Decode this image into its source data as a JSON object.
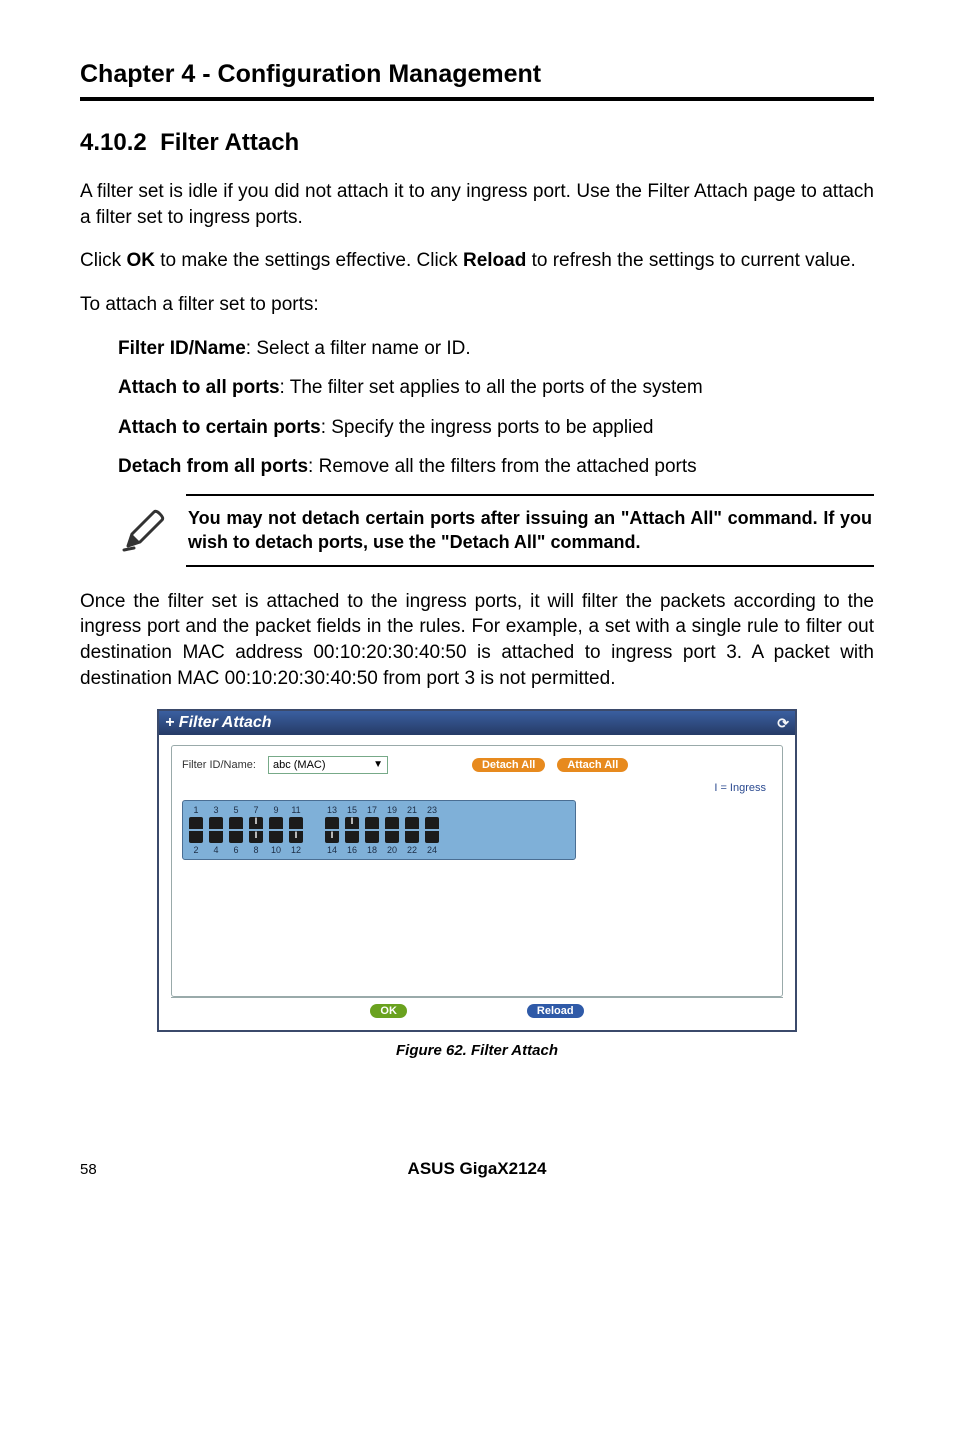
{
  "chapter": "Chapter 4 - Configuration Management",
  "section": {
    "number": "4.10.2",
    "title": "Filter Attach"
  },
  "p1": "A filter set is idle if you did not attach it to any ingress port. Use the Filter Attach page to attach a filter set to ingress ports.",
  "p2_pre": "Click ",
  "p2_ok": "OK",
  "p2_mid": " to make the settings effective. Click ",
  "p2_reload": "Reload",
  "p2_post": " to refresh the settings to current value.",
  "p3": "To attach a filter set to ports:",
  "items": [
    {
      "term": "Filter ID/Name",
      "desc": ": Select a filter name or ID."
    },
    {
      "term": "Attach to all ports",
      "desc": ": The filter set applies to all the ports of the system"
    },
    {
      "term": "Attach to certain ports",
      "desc": ": Specify the ingress ports to be applied"
    },
    {
      "term": "Detach from all ports",
      "desc": ": Remove all the filters from the attached ports"
    }
  ],
  "note": "You may not detach certain ports after issuing an \"Attach All\" command. If you wish to detach ports, use the \"Detach All\" command.",
  "p4": "Once the filter set is attached to the ingress ports, it will filter the packets according to the ingress port and the packet fields in the rules. For example, a set with a single rule to filter out destination MAC address 00:10:20:30:40:50 is attached to ingress port 3. A packet with destination MAC 00:10:20:30:40:50 from port 3 is not permitted.",
  "figure": {
    "title": "Filter Attach",
    "filter_label": "Filter ID/Name:",
    "filter_value": "abc (MAC)",
    "btn_detach": "Detach All",
    "btn_attach": "Attach All",
    "legend": "I = Ingress",
    "ports_top": [
      "1",
      "3",
      "5",
      "7",
      "9",
      "11",
      "13",
      "15",
      "17",
      "19",
      "21",
      "23"
    ],
    "ports_bottom": [
      "2",
      "4",
      "6",
      "8",
      "10",
      "12",
      "14",
      "16",
      "18",
      "20",
      "22",
      "24"
    ],
    "marked_top": [
      false,
      false,
      false,
      true,
      false,
      false,
      false,
      true,
      false,
      false,
      false,
      false
    ],
    "marked_bottom": [
      false,
      false,
      false,
      true,
      false,
      true,
      true,
      false,
      false,
      false,
      false,
      false
    ],
    "btn_ok": "OK",
    "btn_reload": "Reload",
    "caption": "Figure 62. Filter Attach"
  },
  "footer": {
    "page": "58",
    "book": "ASUS GigaX2124"
  }
}
